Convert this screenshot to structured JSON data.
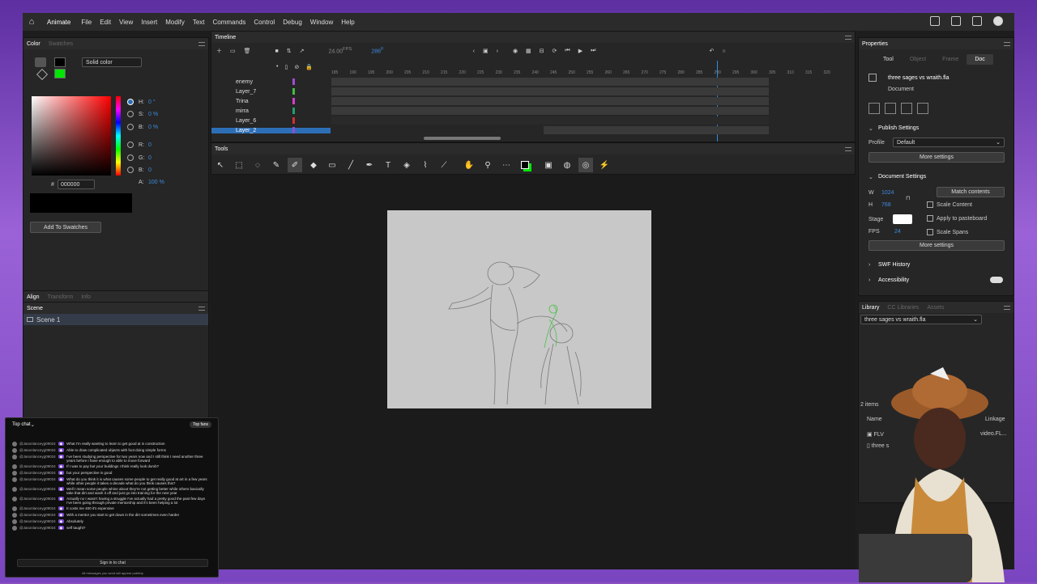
{
  "app": {
    "name": "Animate",
    "home": "⌂"
  },
  "menu": [
    "File",
    "Edit",
    "View",
    "Insert",
    "Modify",
    "Text",
    "Commands",
    "Control",
    "Debug",
    "Window",
    "Help"
  ],
  "color": {
    "tabs": [
      "Color",
      "Swatches"
    ],
    "fill_type": "Solid color",
    "h_label": "H:",
    "h_val": "0 °",
    "s_label": "S:",
    "s_val": "0 %",
    "b_label": "B:",
    "b_val": "0 %",
    "r_label": "R:",
    "r_val": "0",
    "g_label": "G:",
    "g_val": "0",
    "b2_label": "B:",
    "b2_val": "0",
    "a_label": "A:",
    "a_val": "100 %",
    "hex_label": "#",
    "hex_val": "000000",
    "add_swatches": "Add To Swatches",
    "accent": "#00e600"
  },
  "align": {
    "tabs": [
      "Align",
      "Transform",
      "Info"
    ]
  },
  "scene": {
    "title": "Scene",
    "item": "Scene 1"
  },
  "timeline": {
    "title": "Timeline",
    "fps": "24.00",
    "fps_unit": "FPS",
    "frame": "286",
    "frame_unit": "F",
    "ticks": [
      "185",
      "190",
      "195",
      "200",
      "205",
      "210",
      "215",
      "220",
      "225",
      "230",
      "235",
      "240",
      "245",
      "250",
      "255",
      "260",
      "265",
      "270",
      "275",
      "280",
      "285",
      "290",
      "295",
      "300",
      "305",
      "310",
      "315",
      "320"
    ],
    "layers": [
      "enemy",
      "Layer_7",
      "Trina",
      "mirra",
      "Layer_6",
      "Layer_2"
    ],
    "layer_colors": [
      "#a24bd6",
      "#3fbf3f",
      "#d03fd0",
      "#1fa06f",
      "#d0302f",
      "#8e4dd8"
    ]
  },
  "tools": {
    "title": "Tools"
  },
  "properties": {
    "title": "Properties",
    "tabs": [
      "Tool",
      "Object",
      "Frame",
      "Doc"
    ],
    "doc_name": "three sages vs wraith.fla",
    "doc_type": "Document",
    "publish_title": "Publish Settings",
    "profile_label": "Profile",
    "profile_val": "Default",
    "more1": "More settings",
    "docsettings_title": "Document Settings",
    "w_label": "W",
    "w_val": "1024",
    "h_label": "H",
    "h_val": "768",
    "match": "Match contents",
    "scale_content": "Scale Content",
    "stage_label": "Stage",
    "apply_pb": "Apply to pasteboard",
    "fps_label": "FPS",
    "fps_val": "24",
    "scale_spans": "Scale Spans",
    "more2": "More settings",
    "swf": "SWF History",
    "access": "Accessibility"
  },
  "library": {
    "tabs": [
      "Library",
      "CC Libraries",
      "Assets"
    ],
    "file": "three sages vs wraith.fla",
    "count": "2 items",
    "col_name": "Name",
    "col_link": "Linkage",
    "item1": "FLV",
    "item2": "three s",
    "item1_link": "video.FL..."
  },
  "chat": {
    "title": "Top chat",
    "badge": "Top fans",
    "signin": "Sign in to chat",
    "footer": "All messages you send will appear publicly",
    "lines": [
      {
        "u": "@Jasonlanceyg09024",
        "m": "What I'm really wanting to learn to get good at is construction"
      },
      {
        "u": "@Jasonlanceyg09024",
        "m": "Able to draw complicated objects with foot doing simple forms"
      },
      {
        "u": "@Jasonlanceyg09024",
        "m": "I've been studying perspective for two years now and I still think I need another three years before I have enough to able to move forward"
      },
      {
        "u": "@Jasonlanceyg09024",
        "m": "If I was to pay but your buildings I think really look dumb?"
      },
      {
        "u": "@Jasonlanceyg09024",
        "m": "but your perspective is good"
      },
      {
        "u": "@Jasonlanceyg09024",
        "m": "What do you think it is what causes some people to get really good at art in a few years while other people it takes a decade what do you think causes this?"
      },
      {
        "u": "@Jasonlanceyg09024",
        "m": "Well I mean some people whine about they're not getting better while others basically take that dirt and wash it off and just go into training for the next year"
      },
      {
        "u": "@Jasonlanceyg09024",
        "m": "Actually no I wasn't having a struggle I've actually had a pretty good the past few days I've been going through private mentorship and it's been helping a lot"
      },
      {
        "u": "@Jasonlanceyg09024",
        "m": "It costs me 400 it's expensive"
      },
      {
        "u": "@Jasonlanceyg09024",
        "m": "With a mentor you start to get down in the dirt sometimes even harder"
      },
      {
        "u": "@Jasonlanceyg09024",
        "m": "Absolutely"
      },
      {
        "u": "@Jasonlanceyg09024",
        "m": "self taught?"
      }
    ]
  }
}
